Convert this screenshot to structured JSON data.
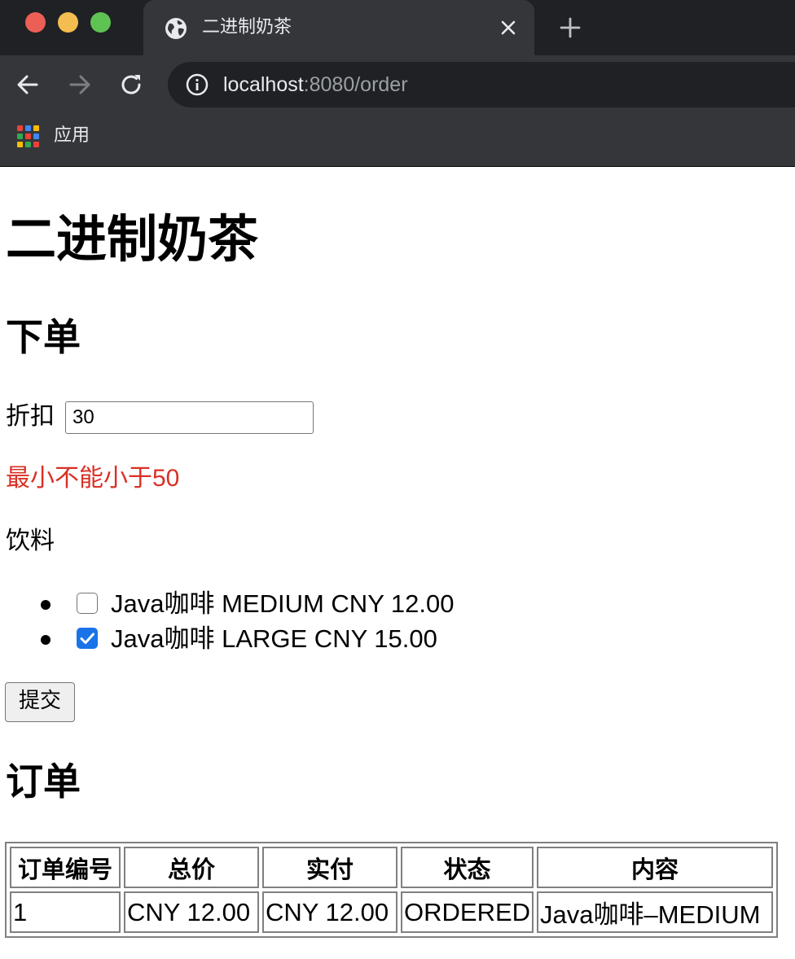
{
  "browser": {
    "tab_title": "二进制奶茶",
    "url_host": "localhost",
    "url_rest": ":8080/order",
    "bookmarks": [
      {
        "label": "应用"
      }
    ]
  },
  "page": {
    "title": "二进制奶茶",
    "order_heading": "下单",
    "discount_label": "折扣",
    "discount_value": "30",
    "error_message": "最小不能小于50",
    "drinks_label": "饮料",
    "drinks": [
      {
        "label": "Java咖啡 MEDIUM CNY 12.00",
        "checked": false
      },
      {
        "label": "Java咖啡 LARGE CNY 15.00",
        "checked": true
      }
    ],
    "submit_label": "提交",
    "orders_heading": "订单",
    "orders_table": {
      "headers": [
        "订单编号",
        "总价",
        "实付",
        "状态",
        "内容"
      ],
      "rows": [
        [
          "1",
          "CNY 12.00",
          "CNY 12.00",
          "ORDERED",
          "Java咖啡–MEDIUM"
        ]
      ]
    }
  },
  "colors": {
    "error": "#d93025",
    "checkbox_checked": "#1a73e8"
  }
}
